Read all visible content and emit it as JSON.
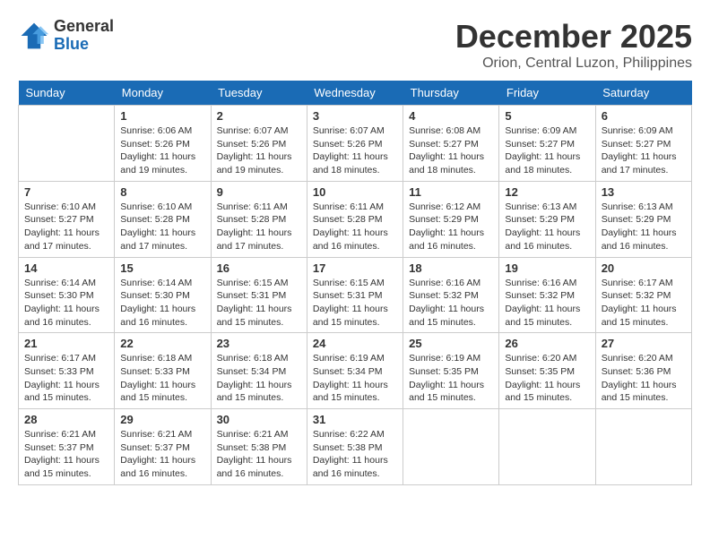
{
  "logo": {
    "general": "General",
    "blue": "Blue"
  },
  "title": {
    "month": "December 2025",
    "location": "Orion, Central Luzon, Philippines"
  },
  "headers": [
    "Sunday",
    "Monday",
    "Tuesday",
    "Wednesday",
    "Thursday",
    "Friday",
    "Saturday"
  ],
  "weeks": [
    [
      {
        "day": "",
        "info": ""
      },
      {
        "day": "1",
        "info": "Sunrise: 6:06 AM\nSunset: 5:26 PM\nDaylight: 11 hours and 19 minutes."
      },
      {
        "day": "2",
        "info": "Sunrise: 6:07 AM\nSunset: 5:26 PM\nDaylight: 11 hours and 19 minutes."
      },
      {
        "day": "3",
        "info": "Sunrise: 6:07 AM\nSunset: 5:26 PM\nDaylight: 11 hours and 18 minutes."
      },
      {
        "day": "4",
        "info": "Sunrise: 6:08 AM\nSunset: 5:27 PM\nDaylight: 11 hours and 18 minutes."
      },
      {
        "day": "5",
        "info": "Sunrise: 6:09 AM\nSunset: 5:27 PM\nDaylight: 11 hours and 18 minutes."
      },
      {
        "day": "6",
        "info": "Sunrise: 6:09 AM\nSunset: 5:27 PM\nDaylight: 11 hours and 17 minutes."
      }
    ],
    [
      {
        "day": "7",
        "info": "Sunrise: 6:10 AM\nSunset: 5:27 PM\nDaylight: 11 hours and 17 minutes."
      },
      {
        "day": "8",
        "info": "Sunrise: 6:10 AM\nSunset: 5:28 PM\nDaylight: 11 hours and 17 minutes."
      },
      {
        "day": "9",
        "info": "Sunrise: 6:11 AM\nSunset: 5:28 PM\nDaylight: 11 hours and 17 minutes."
      },
      {
        "day": "10",
        "info": "Sunrise: 6:11 AM\nSunset: 5:28 PM\nDaylight: 11 hours and 16 minutes."
      },
      {
        "day": "11",
        "info": "Sunrise: 6:12 AM\nSunset: 5:29 PM\nDaylight: 11 hours and 16 minutes."
      },
      {
        "day": "12",
        "info": "Sunrise: 6:13 AM\nSunset: 5:29 PM\nDaylight: 11 hours and 16 minutes."
      },
      {
        "day": "13",
        "info": "Sunrise: 6:13 AM\nSunset: 5:29 PM\nDaylight: 11 hours and 16 minutes."
      }
    ],
    [
      {
        "day": "14",
        "info": "Sunrise: 6:14 AM\nSunset: 5:30 PM\nDaylight: 11 hours and 16 minutes."
      },
      {
        "day": "15",
        "info": "Sunrise: 6:14 AM\nSunset: 5:30 PM\nDaylight: 11 hours and 16 minutes."
      },
      {
        "day": "16",
        "info": "Sunrise: 6:15 AM\nSunset: 5:31 PM\nDaylight: 11 hours and 15 minutes."
      },
      {
        "day": "17",
        "info": "Sunrise: 6:15 AM\nSunset: 5:31 PM\nDaylight: 11 hours and 15 minutes."
      },
      {
        "day": "18",
        "info": "Sunrise: 6:16 AM\nSunset: 5:32 PM\nDaylight: 11 hours and 15 minutes."
      },
      {
        "day": "19",
        "info": "Sunrise: 6:16 AM\nSunset: 5:32 PM\nDaylight: 11 hours and 15 minutes."
      },
      {
        "day": "20",
        "info": "Sunrise: 6:17 AM\nSunset: 5:32 PM\nDaylight: 11 hours and 15 minutes."
      }
    ],
    [
      {
        "day": "21",
        "info": "Sunrise: 6:17 AM\nSunset: 5:33 PM\nDaylight: 11 hours and 15 minutes."
      },
      {
        "day": "22",
        "info": "Sunrise: 6:18 AM\nSunset: 5:33 PM\nDaylight: 11 hours and 15 minutes."
      },
      {
        "day": "23",
        "info": "Sunrise: 6:18 AM\nSunset: 5:34 PM\nDaylight: 11 hours and 15 minutes."
      },
      {
        "day": "24",
        "info": "Sunrise: 6:19 AM\nSunset: 5:34 PM\nDaylight: 11 hours and 15 minutes."
      },
      {
        "day": "25",
        "info": "Sunrise: 6:19 AM\nSunset: 5:35 PM\nDaylight: 11 hours and 15 minutes."
      },
      {
        "day": "26",
        "info": "Sunrise: 6:20 AM\nSunset: 5:35 PM\nDaylight: 11 hours and 15 minutes."
      },
      {
        "day": "27",
        "info": "Sunrise: 6:20 AM\nSunset: 5:36 PM\nDaylight: 11 hours and 15 minutes."
      }
    ],
    [
      {
        "day": "28",
        "info": "Sunrise: 6:21 AM\nSunset: 5:37 PM\nDaylight: 11 hours and 15 minutes."
      },
      {
        "day": "29",
        "info": "Sunrise: 6:21 AM\nSunset: 5:37 PM\nDaylight: 11 hours and 16 minutes."
      },
      {
        "day": "30",
        "info": "Sunrise: 6:21 AM\nSunset: 5:38 PM\nDaylight: 11 hours and 16 minutes."
      },
      {
        "day": "31",
        "info": "Sunrise: 6:22 AM\nSunset: 5:38 PM\nDaylight: 11 hours and 16 minutes."
      },
      {
        "day": "",
        "info": ""
      },
      {
        "day": "",
        "info": ""
      },
      {
        "day": "",
        "info": ""
      }
    ]
  ]
}
